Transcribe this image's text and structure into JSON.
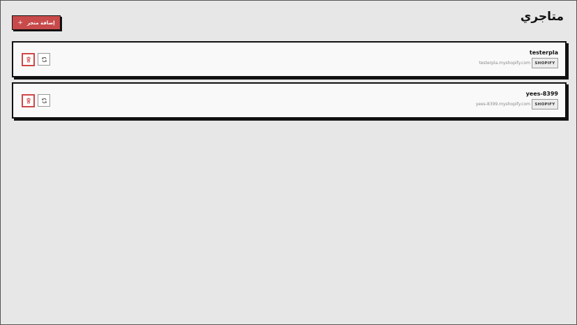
{
  "header": {
    "title": "متاجري",
    "add_store_label": "إضافة متجر",
    "add_icon": "plus-icon"
  },
  "stores": [
    {
      "name": "testerpla",
      "domain": "testerpla.myshopify.com",
      "platform": "SHOPIFY"
    },
    {
      "name": "yees-8399",
      "domain": "yees-8399.myshopify.com",
      "platform": "SHOPIFY"
    }
  ],
  "icons": {
    "delete": "trash-icon",
    "refresh": "refresh-icon"
  },
  "colors": {
    "accent": "#c84a4a",
    "background": "#e7e7e7",
    "card": "#f9f9f9",
    "border": "#111111"
  }
}
